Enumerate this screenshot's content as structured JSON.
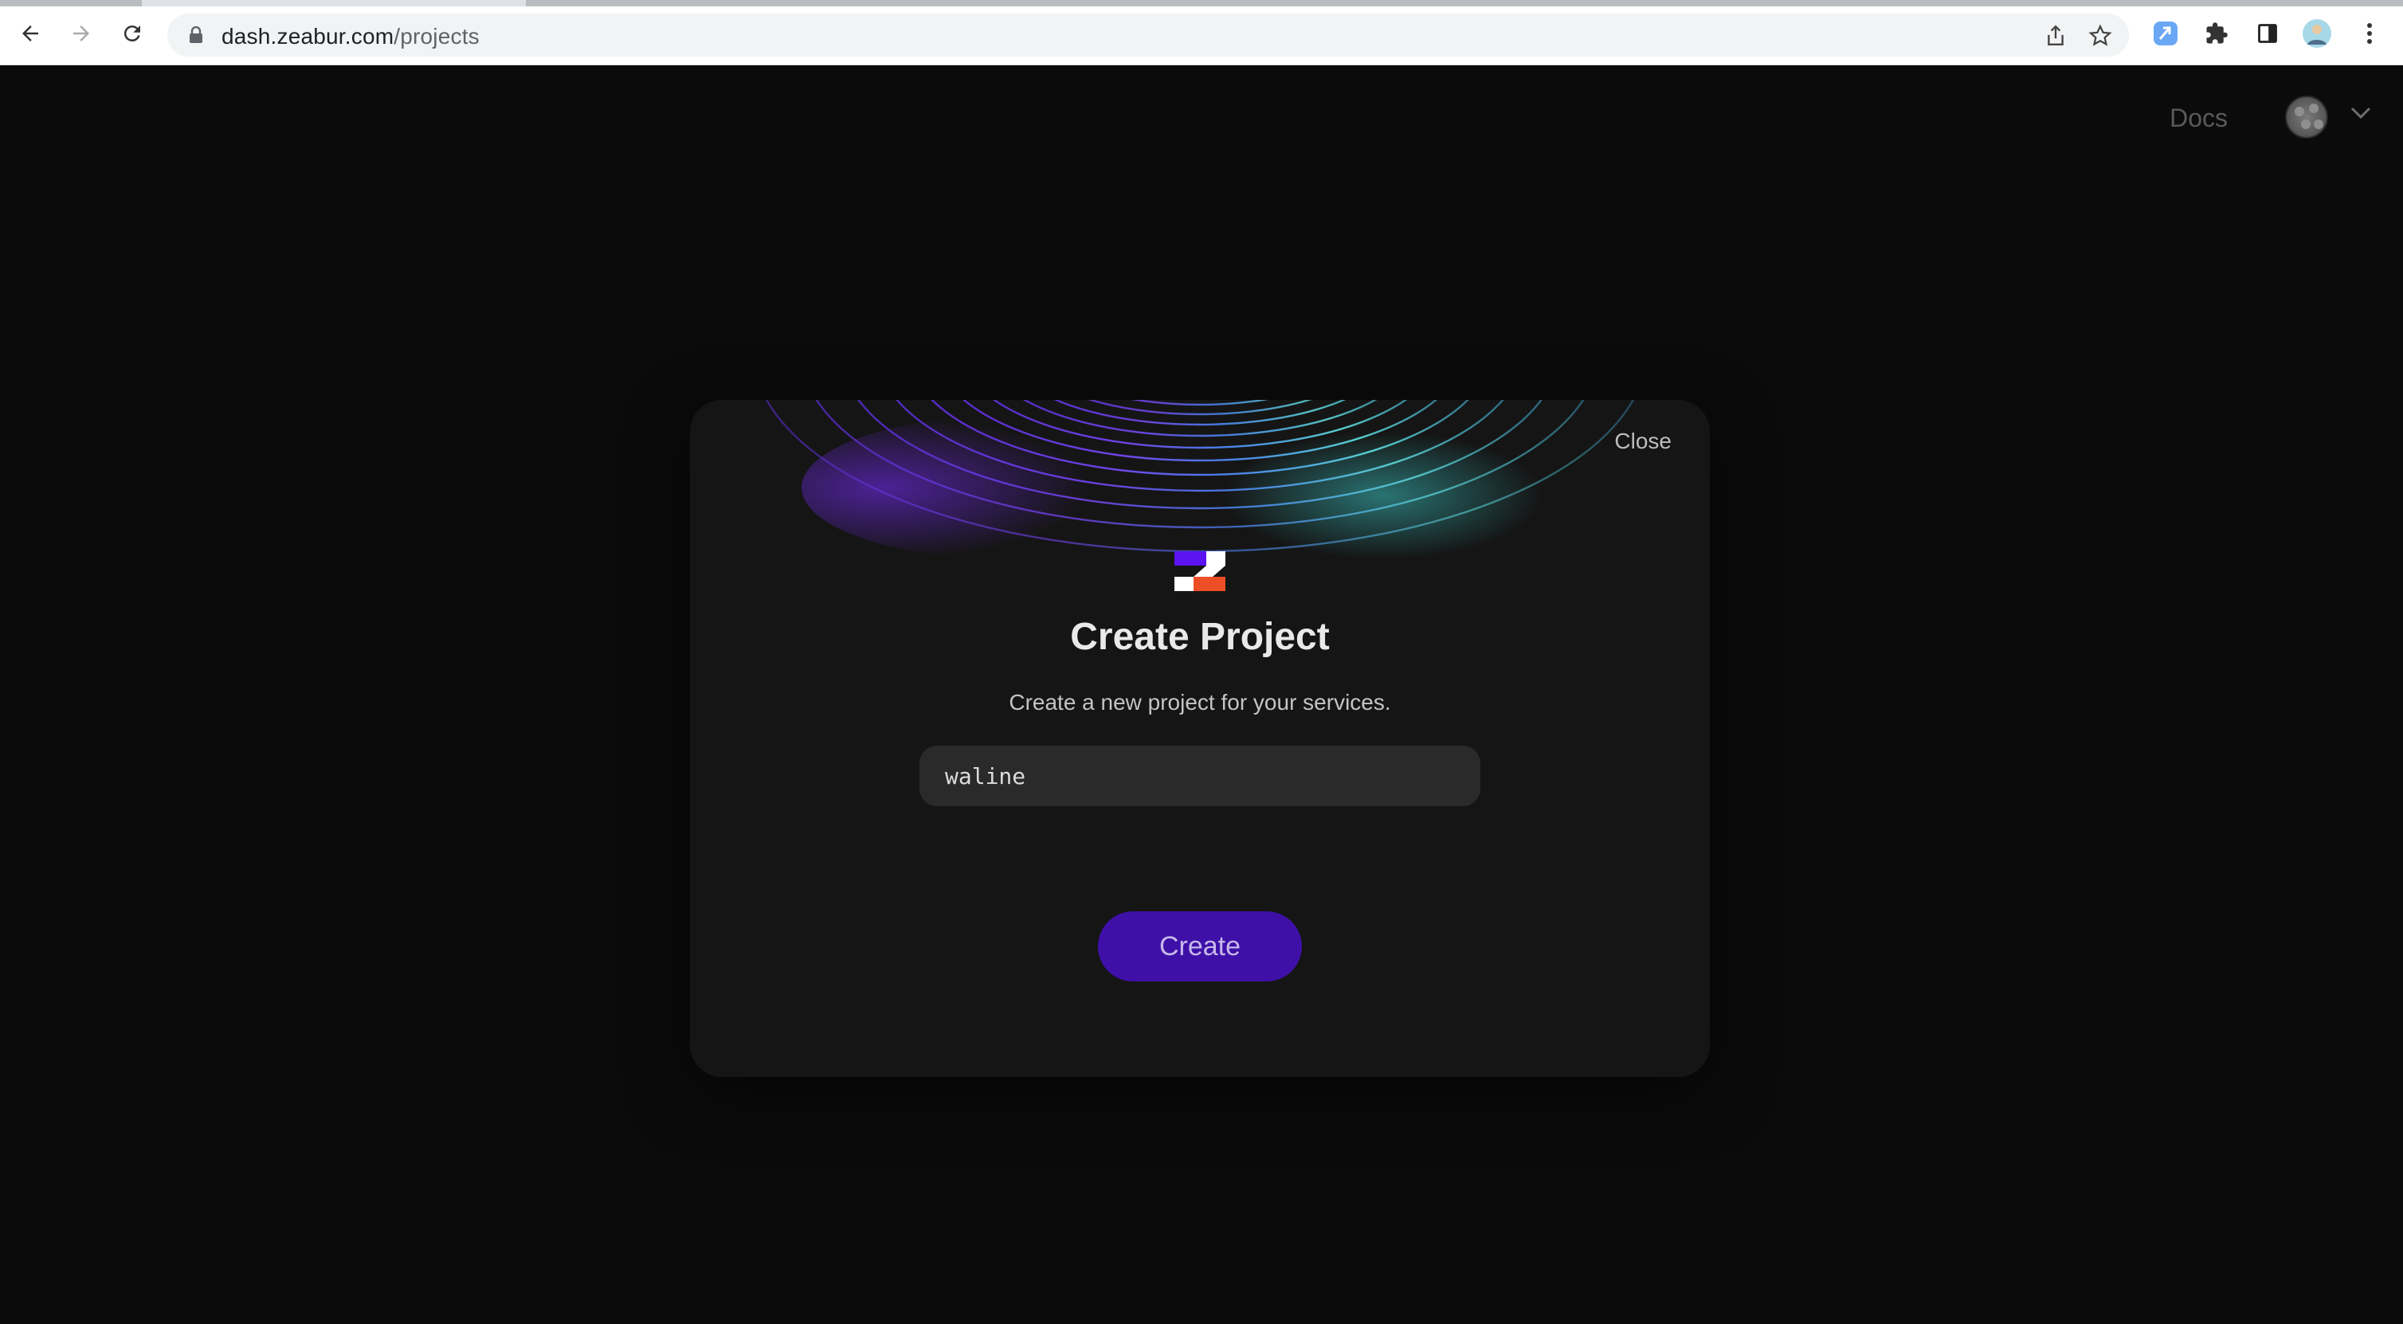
{
  "browser": {
    "url_host": "dash.zeabur.com",
    "url_path": "/projects",
    "icons": {
      "back": "arrow-left-icon",
      "forward": "arrow-right-icon",
      "reload": "reload-icon",
      "lock": "lock-icon",
      "share": "share-icon",
      "bookmark": "star-icon",
      "extension": "extension-icon",
      "puzzle": "puzzle-icon",
      "sidepanel": "side-panel-icon",
      "profile": "profile-avatar",
      "menu": "kebab-menu-icon"
    }
  },
  "header": {
    "docs_label": "Docs",
    "avatar_icon": "user-avatar",
    "dropdown_icon": "chevron-down-icon"
  },
  "modal": {
    "close_label": "Close",
    "logo_icon": "zeabur-logo",
    "title": "Create Project",
    "subtitle": "Create a new project for your services.",
    "project_name_value": "waline",
    "create_label": "Create"
  },
  "colors": {
    "page_bg": "#0b0b0b",
    "modal_bg": "#151515",
    "input_bg": "#2a2a2a",
    "button_bg": "#3f10a8",
    "button_text": "#c6b8ea",
    "logo_purple": "#5b13f2",
    "logo_orange": "#ee4e26"
  }
}
